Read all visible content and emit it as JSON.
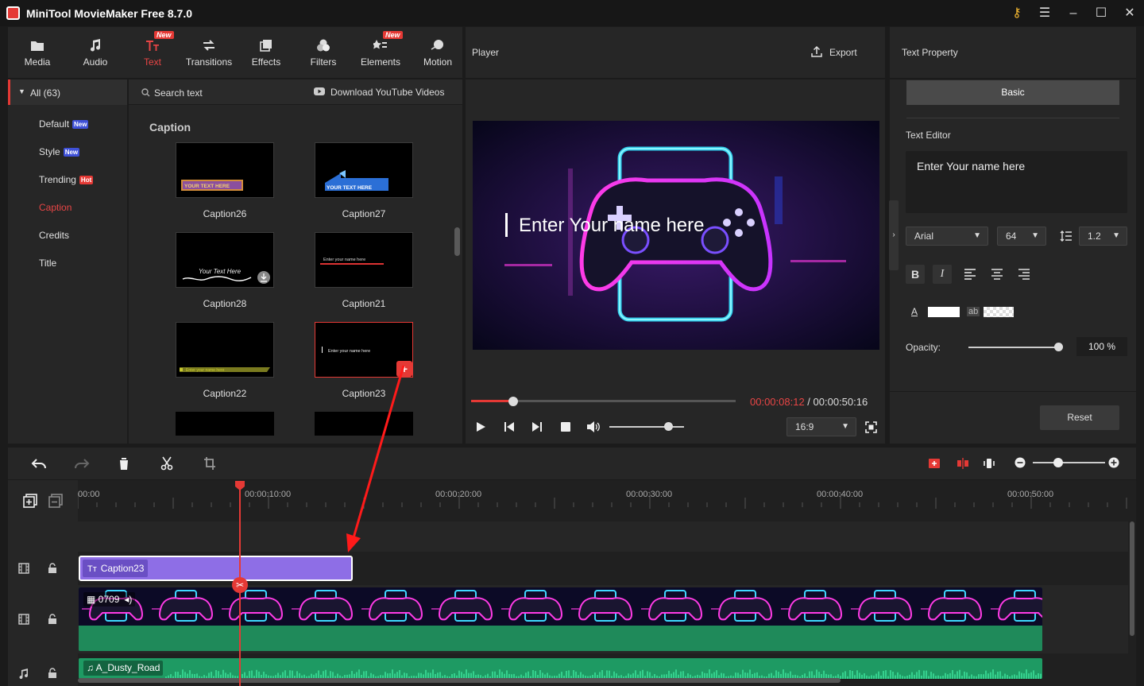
{
  "app": {
    "title": "MiniTool MovieMaker Free 8.7.0"
  },
  "toolbar": {
    "tabs": [
      {
        "label": "Media",
        "icon": "folder-icon"
      },
      {
        "label": "Audio",
        "icon": "music-note-icon"
      },
      {
        "label": "Text",
        "icon": "text-icon",
        "badge": "New",
        "active": true
      },
      {
        "label": "Transitions",
        "icon": "transitions-icon"
      },
      {
        "label": "Effects",
        "icon": "effects-icon"
      },
      {
        "label": "Filters",
        "icon": "filters-icon"
      },
      {
        "label": "Elements",
        "icon": "elements-icon",
        "badge": "New"
      },
      {
        "label": "Motion",
        "icon": "motion-icon"
      }
    ]
  },
  "categories": {
    "all_label": "All (63)",
    "items": [
      {
        "label": "Default",
        "badge": "New"
      },
      {
        "label": "Style",
        "badge": "New"
      },
      {
        "label": "Trending",
        "badge": "Hot"
      },
      {
        "label": "Caption",
        "active": true
      },
      {
        "label": "Credits"
      },
      {
        "label": "Title"
      }
    ]
  },
  "gallery": {
    "search_placeholder": "Search text",
    "download_label": "Download YouTube Videos",
    "section_title": "Caption",
    "items": [
      {
        "label": "Caption26",
        "preview_text": "YOUR TEXT HERE"
      },
      {
        "label": "Caption27",
        "preview_text": "YOUR TEXT HERE"
      },
      {
        "label": "Caption28",
        "preview_text": "Your Text Here"
      },
      {
        "label": "Caption21",
        "preview_text": "Enter your name here"
      },
      {
        "label": "Caption22",
        "preview_text": "Enter your name here"
      },
      {
        "label": "Caption23",
        "preview_text": "Enter your name here",
        "selected": true
      }
    ]
  },
  "player": {
    "title": "Player",
    "export_label": "Export",
    "overlay_text": "Enter Your name here",
    "current_time": "00:00:08:12",
    "separator": " / ",
    "total_time": "00:00:50:16",
    "aspect_ratio": "16:9",
    "progress": 0.16,
    "volume": 0.8
  },
  "property": {
    "title": "Text Property",
    "tab_basic": "Basic",
    "text_editor_label": "Text Editor",
    "text_value": "Enter Your name here",
    "font": "Arial",
    "font_size": "64",
    "line_spacing": "1.2",
    "text_color_glyph": "A",
    "bg_color_glyph": "ab",
    "opacity_label": "Opacity:",
    "opacity_value": "100 %",
    "opacity": 1.0,
    "reset_label": "Reset"
  },
  "timeline": {
    "ruler": [
      "00:00",
      "00:00:10:00",
      "00:00:20:00",
      "00:00:30:00",
      "00:00:40:00",
      "00:00:50:00"
    ],
    "text_clip": "Caption23",
    "video_clip": "0709",
    "audio_clip": "A_Dusty_Road",
    "zoom": 0.35
  },
  "colors": {
    "accent": "#e53935",
    "text_clip": "#8e6ee6",
    "video_clip": "#1f8a5a",
    "audio_clip": "#1e9a63"
  }
}
